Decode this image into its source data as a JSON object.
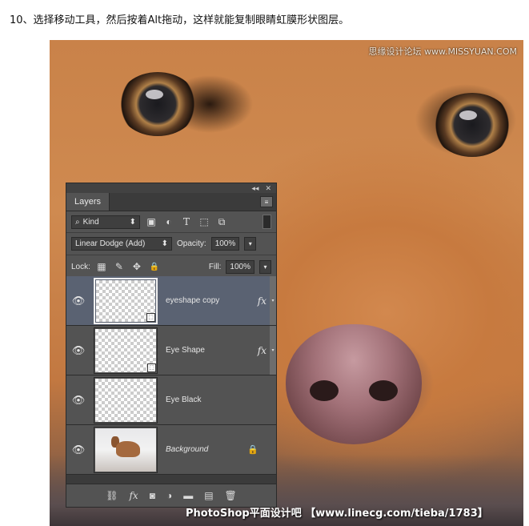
{
  "caption": "10、选择移动工具，然后按着Alt拖动，这样就能复制眼睛虹膜形状图层。",
  "watermarks": {
    "top": "思缘设计论坛 www.MISSYUAN.COM",
    "bottom": "PhotoShop平面设计吧 【www.linecg.com/tieba/1783】"
  },
  "panel": {
    "tab_label": "Layers",
    "collapse_glyph": "◂◂",
    "close_glyph": "✕",
    "menu_glyph": "≡",
    "filter": {
      "search_glyph": "⌕",
      "kind_label": "Kind",
      "arrows": "⬍"
    },
    "filter_icons": [
      {
        "name": "image-filter-icon",
        "glyph": "▣"
      },
      {
        "name": "adjustment-filter-icon",
        "glyph": "◐"
      },
      {
        "name": "type-filter-icon",
        "glyph": "T"
      },
      {
        "name": "shape-filter-icon",
        "glyph": "⬚"
      },
      {
        "name": "smart-object-filter-icon",
        "glyph": "⧉"
      }
    ],
    "blend_mode": "Linear Dodge (Add)",
    "opacity_label": "Opacity:",
    "opacity_value": "100%",
    "lock_label": "Lock:",
    "fill_label": "Fill:",
    "fill_value": "100%",
    "lock_icons": [
      {
        "name": "lock-transparent-icon",
        "glyph": "▦"
      },
      {
        "name": "lock-pixels-icon",
        "glyph": "✎"
      },
      {
        "name": "lock-position-icon",
        "glyph": "✥"
      },
      {
        "name": "lock-all-icon",
        "glyph": "🔒"
      }
    ],
    "layers": [
      {
        "name": "eyeshape copy",
        "selected": true,
        "fx": "fx",
        "italic": false
      },
      {
        "name": "Eye Shape",
        "selected": false,
        "fx": "fx",
        "italic": false
      },
      {
        "name": "Eye Black",
        "selected": false,
        "fx": "",
        "italic": false
      },
      {
        "name": "Background",
        "selected": false,
        "fx": "",
        "italic": true,
        "locked": true
      }
    ],
    "footer_icons": [
      {
        "name": "link-layers-icon",
        "glyph": "⛓"
      },
      {
        "name": "fx-icon",
        "glyph": "fx"
      },
      {
        "name": "add-mask-icon",
        "glyph": "◙"
      },
      {
        "name": "new-adjustment-icon",
        "glyph": "◑"
      },
      {
        "name": "new-group-icon",
        "glyph": "▬"
      },
      {
        "name": "new-layer-icon",
        "glyph": "▤"
      },
      {
        "name": "delete-layer-icon",
        "glyph": "🗑"
      }
    ]
  }
}
